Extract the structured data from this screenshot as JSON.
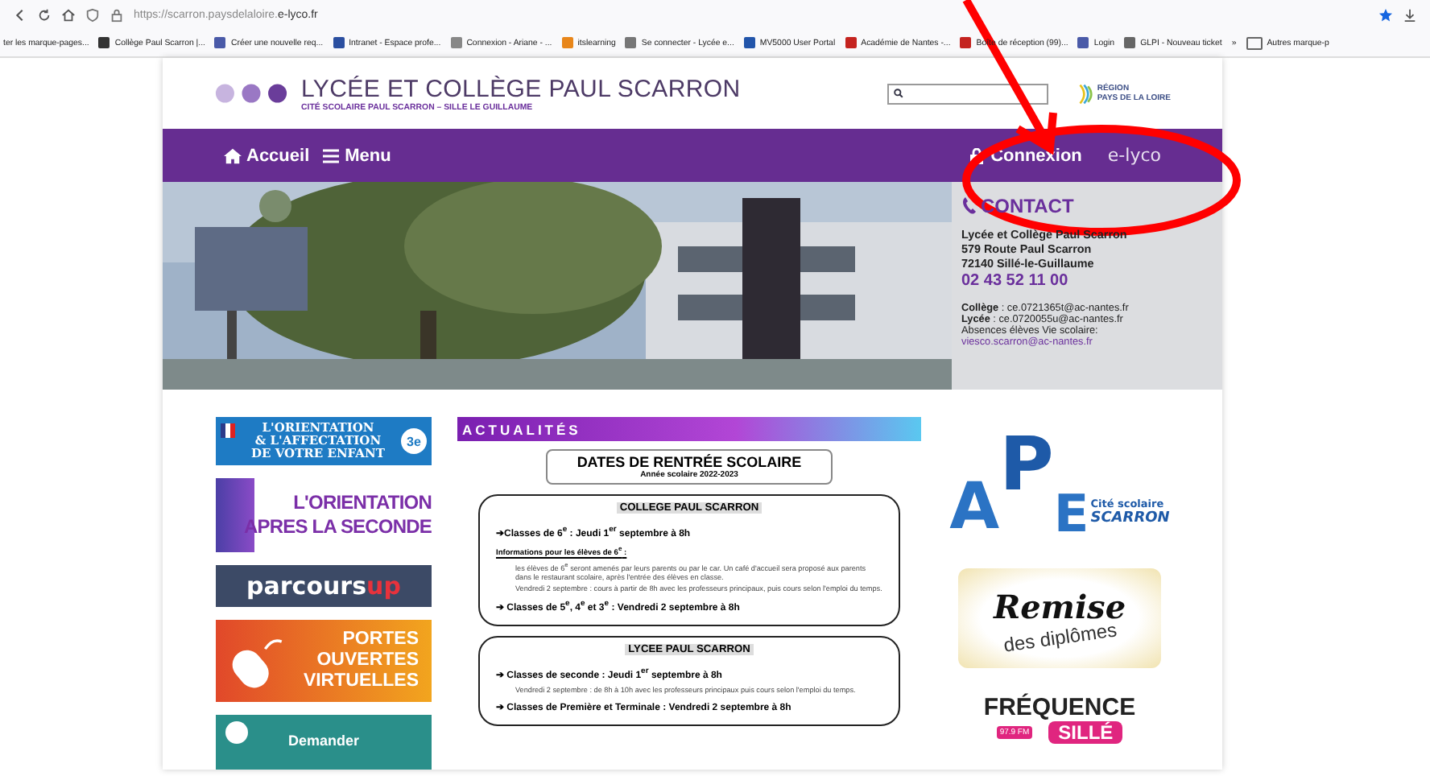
{
  "browser": {
    "url_host": "https://scarron.paysdelaloire.",
    "url_domain": "e-lyco.fr",
    "bookmarks": [
      "ter les marque-pages...",
      "Collège Paul Scarron |...",
      "Créer une nouvelle req...",
      "Intranet - Espace profe...",
      "Connexion - Ariane - ...",
      "itslearning",
      "Se connecter - Lycée e...",
      "MV5000 User Portal",
      "Académie de Nantes -...",
      "Boîte de réception (99)...",
      "Login",
      "GLPI - Nouveau ticket"
    ],
    "more": "»",
    "other_bookmarks": "Autres marque-p"
  },
  "header": {
    "title": "LYCÉE ET COLLÈGE PAUL SCARRON",
    "subtitle": "CITÉ SCOLAIRE PAUL SCARRON – SILLE LE GUILLAUME",
    "region_small": "RÉGION",
    "region": "PAYS DE LA LOIRE"
  },
  "nav": {
    "items": [
      "Accueil",
      "Menu"
    ],
    "login": "Connexion",
    "brand": "e-lyco"
  },
  "contact": {
    "title": "CONTACT",
    "lines": [
      "Lycée et Collège Paul Scarron",
      "579 Route Paul Scarron",
      "72140 Sillé-le-Guillaume"
    ],
    "phone": "02 43 52 11 00",
    "emails": [
      {
        "label": "Collège",
        "value": " : ce.0721365t@ac-nantes.fr"
      },
      {
        "label": "Lycée",
        "value": " : ce.0720055u@ac-nantes.fr"
      }
    ],
    "absences": "Absences élèves Vie scolaire: ",
    "absences_link": "viesco.scarron@ac-nantes.fr"
  },
  "banners": [
    {
      "kind": "orientation3",
      "texts": [
        "L'ORIENTATION",
        "& L'AFFECTATION",
        "DE VOTRE ENFANT",
        "3e"
      ]
    },
    {
      "kind": "seconde",
      "texts": [
        "L'ORIENTATION",
        "APRES LA SECONDE"
      ]
    },
    {
      "kind": "parcoursup",
      "texts": [
        "parcours",
        "up"
      ]
    },
    {
      "kind": "portes",
      "texts": [
        "PORTES",
        "OUVERTES",
        "VIRTUELLES"
      ]
    },
    {
      "kind": "demander",
      "texts": [
        "Demander"
      ]
    }
  ],
  "news": {
    "heading": "ACTUALITÉS",
    "flyer_title": "DATES DE RENTRÉE SCOLAIRE",
    "flyer_subtitle": "Année scolaire 2022-2023",
    "sections": [
      {
        "title": "COLLEGE PAUL SCARRON",
        "lines": [
          {
            "kind": "class",
            "text": "➔Classes de 6$^{e}$ : Jeudi 1$^{er}$ septembre à 8h"
          },
          {
            "kind": "info",
            "text": "Informations pour les élèves de 6$^{e}$ :"
          },
          {
            "kind": "bullet",
            "text": "les élèves de 6$^{e}$ seront amenés par leurs parents ou par le car. Un café d'accueil sera proposé aux parents dans le restaurant scolaire, après l'entrée des élèves en classe."
          },
          {
            "kind": "bullet",
            "text": "Vendredi 2 septembre : cours à partir de 8h avec les professeurs principaux, puis cours selon l'emploi du temps."
          },
          {
            "kind": "class",
            "text": "➔ Classes de 5$^{e}$, 4$^{e}$ et 3$^{e}$ : Vendredi 2 septembre à 8h"
          }
        ]
      },
      {
        "title": "LYCEE PAUL SCARRON",
        "lines": [
          {
            "kind": "class",
            "text": "➔ Classes de seconde : Jeudi 1$^{er}$ septembre à 8h"
          },
          {
            "kind": "bullet",
            "text": "Vendredi 2 septembre : de 8h à 10h avec les professeurs principaux puis cours selon l'emploi du temps."
          },
          {
            "kind": "class",
            "text": "➔ Classes de Première et Terminale : Vendredi 2 septembre à 8h"
          }
        ]
      }
    ]
  },
  "partners": [
    {
      "kind": "ape",
      "texts": [
        "A",
        "P",
        "E",
        "Cité scolaire",
        "SCARRON"
      ]
    },
    {
      "kind": "remise",
      "texts": [
        "Remise",
        "des diplômes"
      ]
    },
    {
      "kind": "radio",
      "texts": [
        "FRÉQUENCE",
        "97.9 FM",
        "SILLÉ"
      ]
    }
  ]
}
